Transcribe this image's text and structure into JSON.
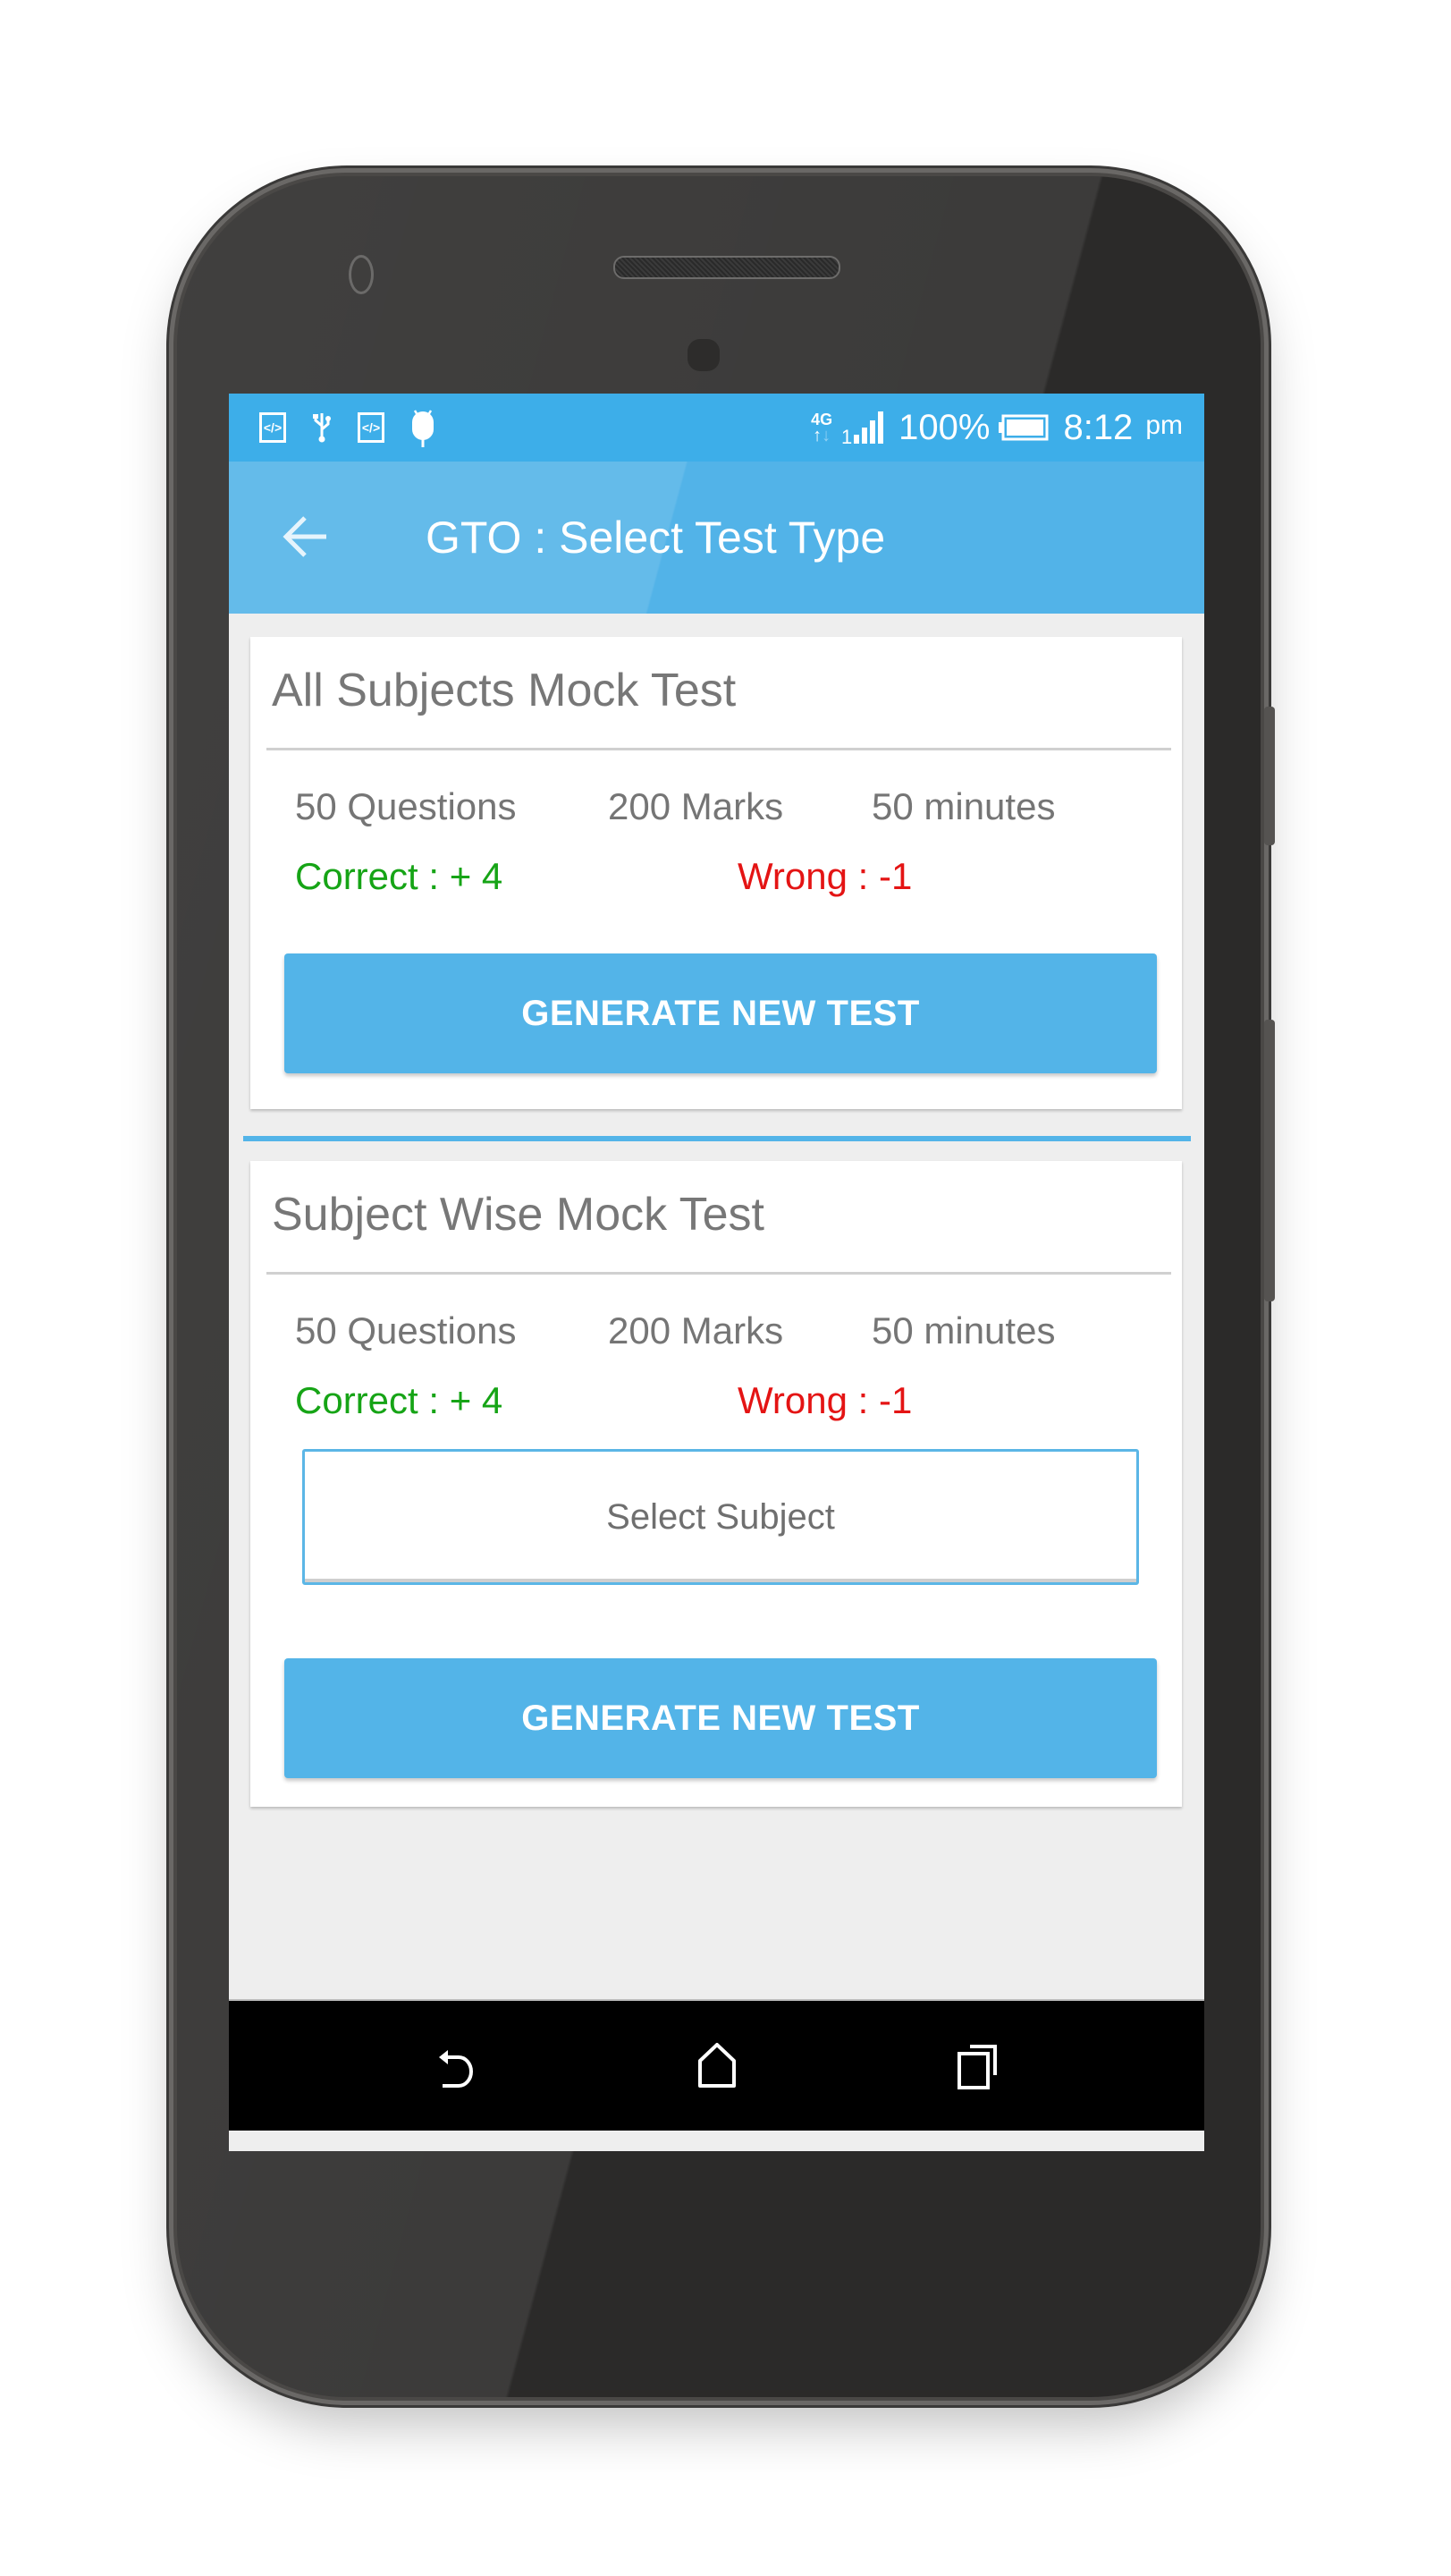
{
  "status_bar": {
    "left_icons": [
      "code-icon",
      "usb-icon",
      "code-icon",
      "android-debug-icon"
    ],
    "network": "4G",
    "signal_icon": "signal-icon",
    "battery_percent": "100%",
    "battery_icon": "battery-icon",
    "time": "8:12",
    "time_suffix": "pm"
  },
  "app_bar": {
    "back_icon": "arrow-left-icon",
    "title": "GTO : Select Test Type"
  },
  "colors": {
    "primary": "#52b3e8",
    "status_bar": "#3daee9",
    "correct": "#16a416",
    "wrong": "#e41414",
    "background": "#eeeeee"
  },
  "cards": [
    {
      "title": "All Subjects Mock Test",
      "questions": "50 Questions",
      "marks": "200 Marks",
      "duration": "50 minutes",
      "correct": "Correct : + 4",
      "wrong": "Wrong : -1",
      "button_label": "GENERATE NEW TEST"
    },
    {
      "title": "Subject Wise Mock Test",
      "questions": "50 Questions",
      "marks": "200 Marks",
      "duration": "50 minutes",
      "correct": "Correct : + 4",
      "wrong": "Wrong : -1",
      "select_label": "Select Subject",
      "button_label": "GENERATE NEW TEST"
    }
  ],
  "nav_bar": {
    "buttons": [
      "back-icon",
      "home-icon",
      "recent-apps-icon"
    ]
  }
}
